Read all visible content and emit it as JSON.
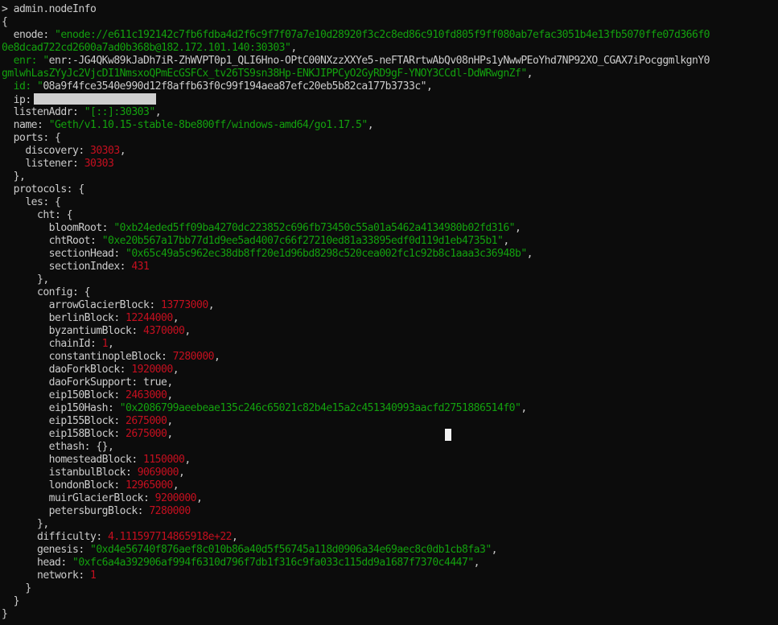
{
  "terminal": {
    "command": "> admin.nodeInfo",
    "lines": [
      "{",
      "  enode: \"enode://e611c192142c7fb6fdba4d2f6c9f7f07a7e10d28920f3c2c8ed86c910fd805f9ff080ab7efac3051b4e13fb5070ffe07d366f0",
      "0e8dcad722cd2600a7ad0b368b@182.172.101.140:30303\",",
      "  enr: \"enr:-JG4QKw89kJaDh7iR-ZhWVPT0p1_QLI6Hno-OPtC00NXzzXXYe5-neFTARrtwAbQv08nHPs1yNwwPEoYhd7NP92XO_CGAX7iPocggmlkgnY0",
      "gmlwhLasZYyJc2VjcDI1NmsxoQPmEcGSFCx_tv26TS9sn38Hp-ENKJIPPCyO2GyRD9gF-YNOY3CCdl-DdWRwgnZf\",",
      "  id: \"08a9f4fce3540e990d12f8affb63f0c99f194aea87efc20eb5b82ca177b3733c\",",
      "  ip:",
      "  listenAddr: \"[::]:30303\",",
      "  name: \"Geth/v1.10.15-stable-8be800ff/windows-amd64/go1.17.5\",",
      "  ports: {",
      "    discovery: 30303,",
      "    listener: 30303",
      "  },",
      "  protocols: {",
      "    les: {",
      "      cht: {",
      "        bloomRoot: \"0xb24eded5ff09ba4270dc223852c696fb73450c55a01a5462a4134980b02fd316\",",
      "        chtRoot: \"0xe20b567a17bb77d1d9ee5ad4007c66f27210ed81a33895edf0d119d1eb4735b1\",",
      "        sectionHead: \"0x65c49a5c962ec38db8ff20e1d96bd8298c520cea002fc1c92b8c1aaa3c36948b\",",
      "        sectionIndex: 431",
      "      },",
      "      config: {",
      "        arrowGlacierBlock: 13773000,",
      "        berlinBlock: 12244000,",
      "        byzantiumBlock: 4370000,",
      "        chainId: 1,",
      "        constantinopleBlock: 7280000,",
      "        daoForkBlock: 1920000,",
      "        daoForkSupport: true,",
      "        eip150Block: 2463000,",
      "        eip150Hash: \"0x2086799aeebeae135c246c65021c82b4e15a2c451340993aacfd2751886514f0\",",
      "        eip155Block: 2675000,",
      "        eip158Block: 2675000,",
      "        ethash: {},",
      "        homesteadBlock: 1150000,",
      "        istanbulBlock: 9069000,",
      "        londonBlock: 12965000,",
      "        muirGlacierBlock: 9200000,",
      "        petersburgBlock: 7280000",
      "      },",
      "      difficulty: 4.111597714865918e+22,",
      "      genesis: \"0xd4e56740f876aef8c010b86a40d5f56745a118d0906a34e69aec8c0db1cb8fa3\",",
      "      head: \"0xfc6a4a392906af994f6310d796f7db1f316c9fa033c115dd9a1687f7370c4447\",",
      "      network: 1",
      "    }",
      "  }",
      "}"
    ]
  },
  "colors": {
    "background": "#0c0c0c",
    "text": "#cccccc",
    "string": "#13a10e",
    "number": "#c50f1f",
    "cursor": "#f2f2f2"
  }
}
